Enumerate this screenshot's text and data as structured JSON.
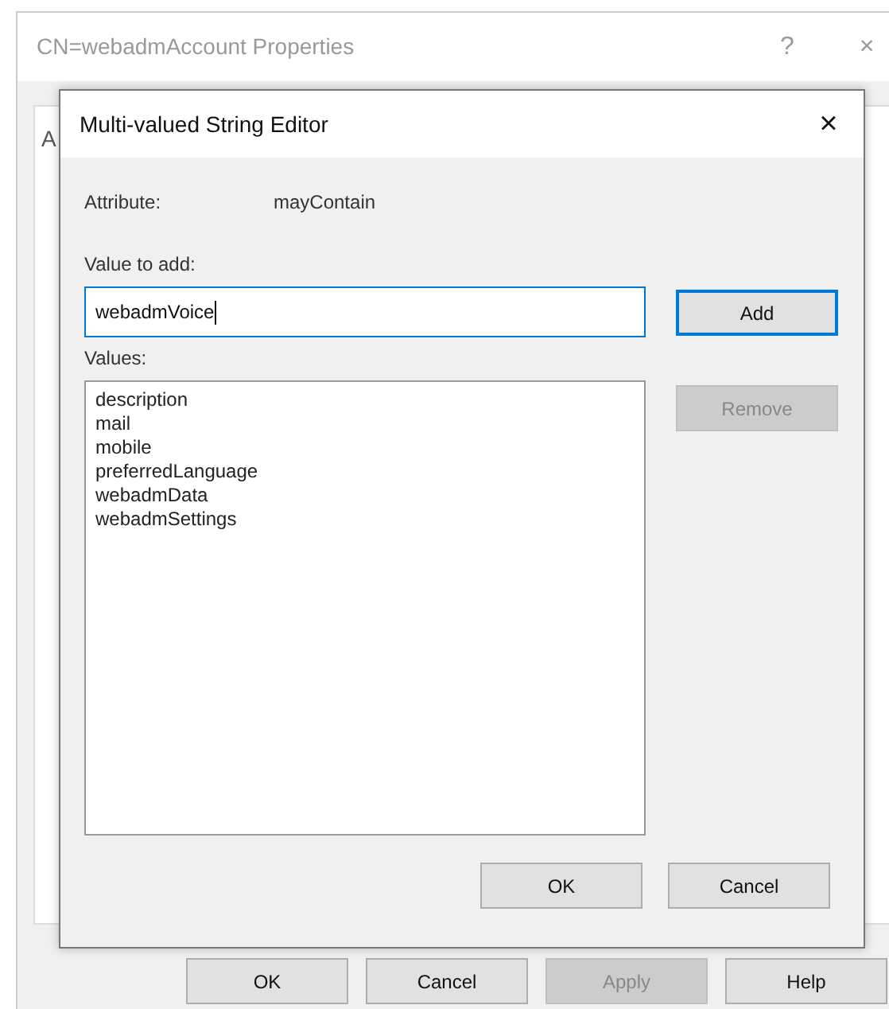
{
  "window": {
    "title": "CN=webadmAccount Properties",
    "help": "?",
    "close": "×",
    "tab_label": "A"
  },
  "dialog": {
    "title": "Multi-valued String Editor",
    "close": "×",
    "attribute_label": "Attribute:",
    "attribute_value": "mayContain",
    "value_label": "Value to add:",
    "value": "webadmVoice",
    "values_label": "Values:",
    "values": [
      "description",
      "mail",
      "mobile",
      "preferredLanguage",
      "webadmData",
      "webadmSettings"
    ],
    "side_buttons": [
      {
        "label": "Add",
        "disabled": false,
        "default": true
      },
      {
        "label": "Remove",
        "disabled": true,
        "default": false
      }
    ],
    "buttons": [
      {
        "label": "OK",
        "disabled": false
      },
      {
        "label": "Cancel",
        "disabled": false
      }
    ]
  },
  "buttons": [
    {
      "label": "OK",
      "disabled": false
    },
    {
      "label": "Cancel",
      "disabled": false
    },
    {
      "label": "Apply",
      "disabled": true
    },
    {
      "label": "Help",
      "disabled": false
    }
  ]
}
